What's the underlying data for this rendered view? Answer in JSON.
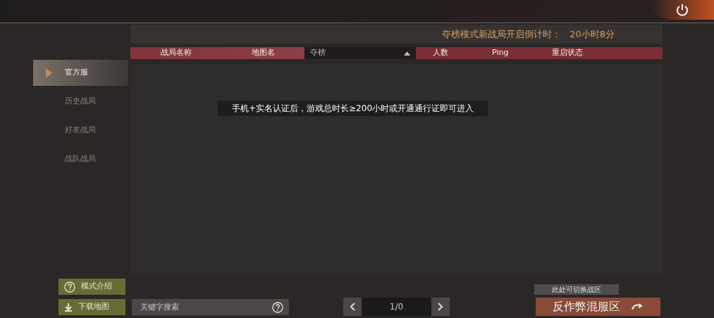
{
  "countdown": {
    "label": "夺榜模式新战局开启倒计时：",
    "value": "20小时8分"
  },
  "table": {
    "columns": [
      {
        "label": "战局名称",
        "kind": "plain"
      },
      {
        "label": "地图名",
        "kind": "plain"
      },
      {
        "label": "夺榜",
        "kind": "dropdown"
      },
      {
        "label": "人数",
        "kind": "plain"
      },
      {
        "label": "Ping",
        "kind": "plain"
      },
      {
        "label": "重启状态",
        "kind": "plain"
      }
    ],
    "notice": "手机+实名认证后，游戏总时长≥200小时或开通通行证即可进入"
  },
  "sidebar": {
    "items": [
      {
        "label": "官方服",
        "selected": true
      },
      {
        "label": "历史战局",
        "selected": false
      },
      {
        "label": "好友战局",
        "selected": false
      },
      {
        "label": "战队战局",
        "selected": false
      }
    ]
  },
  "mode_button": "模式介绍",
  "download_button": "下载地图",
  "search": {
    "placeholder": "关键字搜索"
  },
  "pager": "1/0",
  "tooltip": "此处可切换战区",
  "server_button": "反作弊混服区"
}
